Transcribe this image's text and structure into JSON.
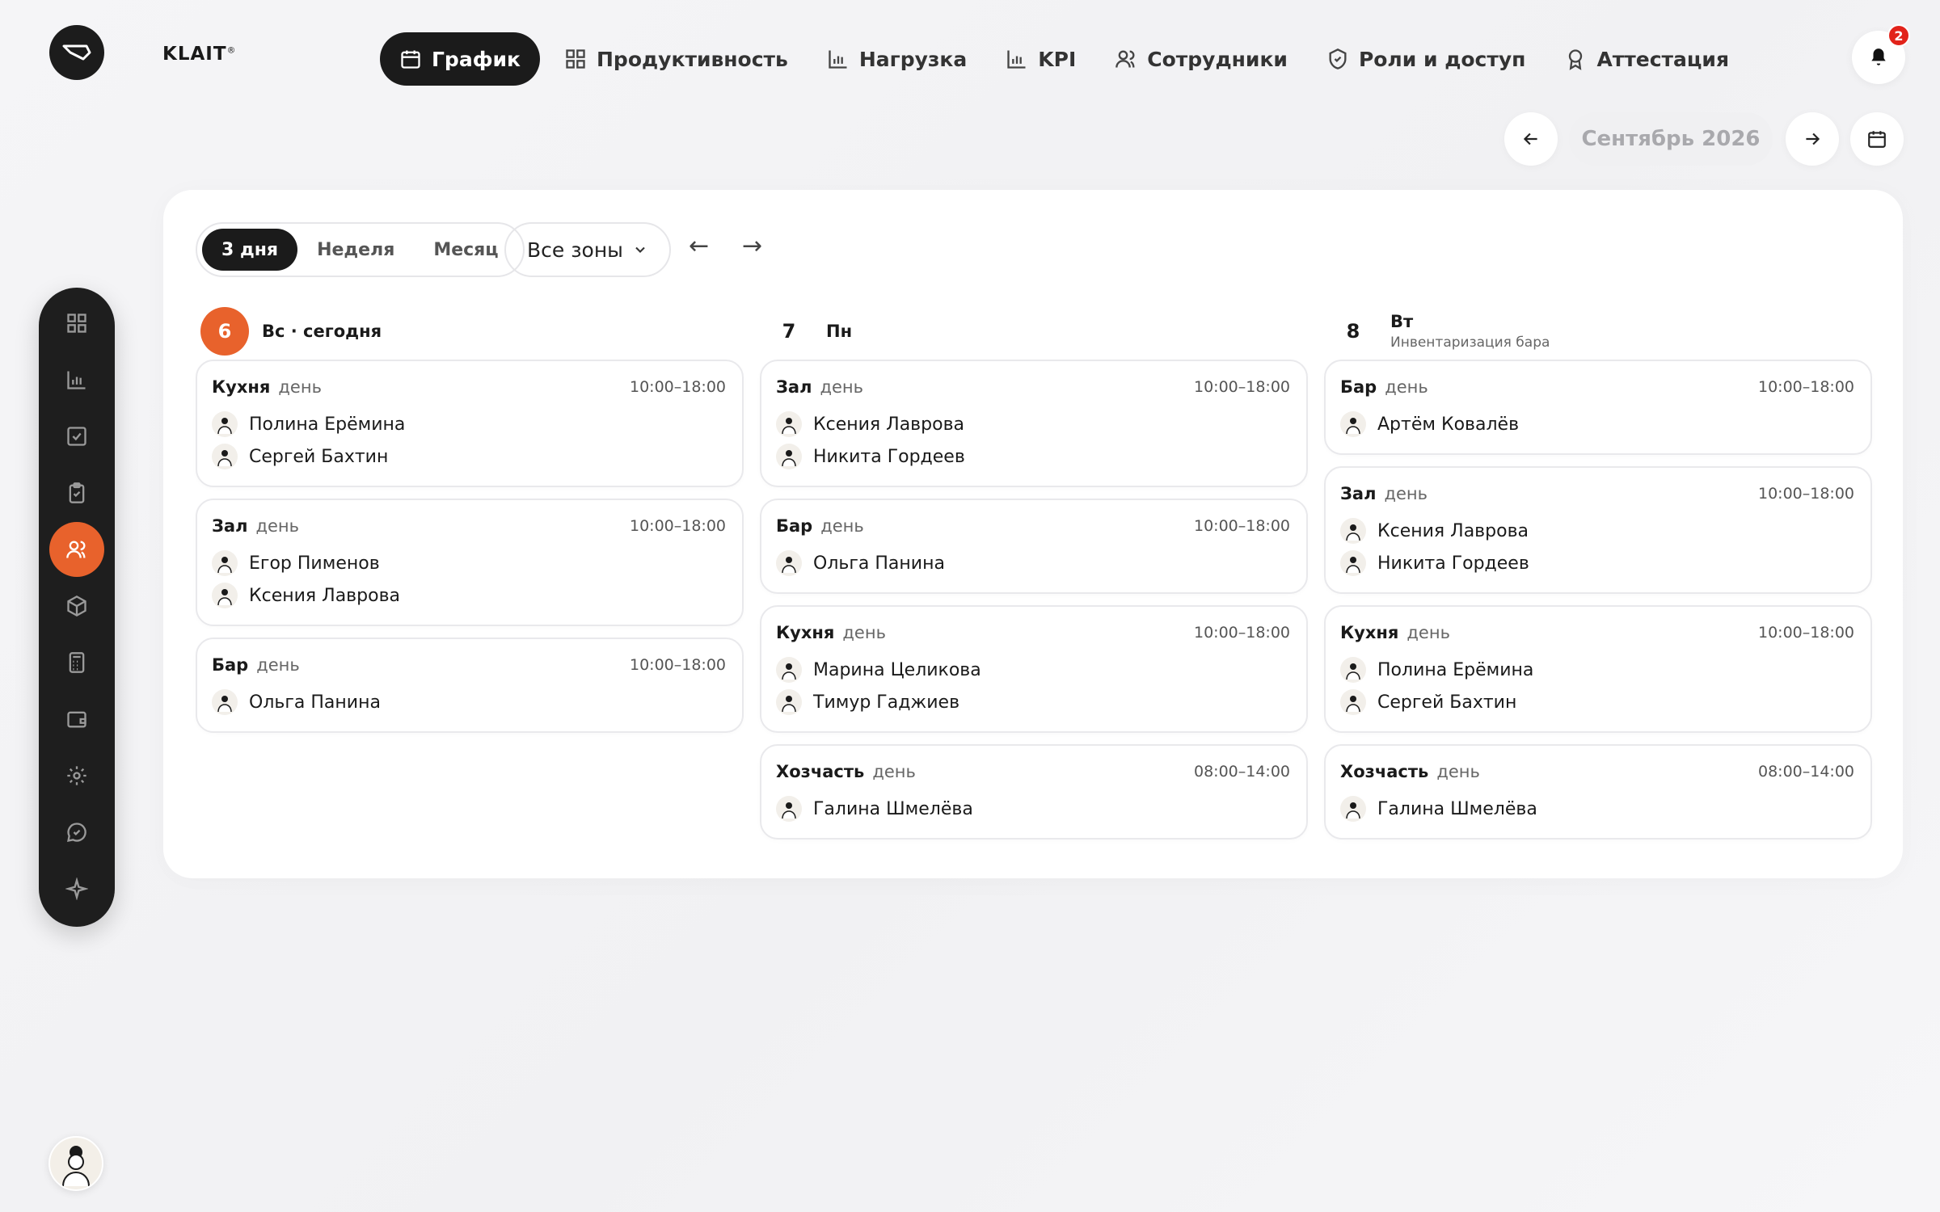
{
  "brand": {
    "name": "KLAIT",
    "mark": "®"
  },
  "nav": [
    {
      "label": "График",
      "icon": "calendar-icon",
      "active": true
    },
    {
      "label": "Продуктивность",
      "icon": "grid-icon"
    },
    {
      "label": "Нагрузка",
      "icon": "bar-chart-icon"
    },
    {
      "label": "KPI",
      "icon": "bar-chart-icon"
    },
    {
      "label": "Сотрудники",
      "icon": "users-icon"
    },
    {
      "label": "Роли и доступ",
      "icon": "shield-icon"
    },
    {
      "label": "Аттестация",
      "icon": "award-icon"
    }
  ],
  "notifications": {
    "count": "2",
    "icon": "bell-icon"
  },
  "month": {
    "label": "Сентябрь 2026"
  },
  "sidebar": {
    "items": [
      {
        "icon": "grid-icon"
      },
      {
        "icon": "bar-chart-icon"
      },
      {
        "icon": "checkbox-icon"
      },
      {
        "icon": "clipboard-icon"
      },
      {
        "icon": "users-icon",
        "active": true
      },
      {
        "icon": "box-icon"
      },
      {
        "icon": "calculator-icon"
      },
      {
        "icon": "wallet-icon"
      },
      {
        "icon": "gear-icon"
      },
      {
        "icon": "chat-icon"
      },
      {
        "icon": "sparkle-icon"
      }
    ],
    "accent": "#e8622c"
  },
  "view": {
    "options": [
      "3 дня",
      "Неделя",
      "Месяц"
    ],
    "active": "3 дня",
    "zones_label": "Все зоны",
    "prev": "←",
    "next": "→"
  },
  "days": [
    {
      "num": "6",
      "name": "Вс · сегодня",
      "note": "",
      "today": true,
      "cards": [
        {
          "zone": "Кухня",
          "shift": "день",
          "time": "10:00–18:00",
          "people": [
            "Полина Ерёмина",
            "Сергей Бахтин"
          ]
        },
        {
          "zone": "Зал",
          "shift": "день",
          "time": "10:00–18:00",
          "people": [
            "Егор Пименов",
            "Ксения Лаврова"
          ]
        },
        {
          "zone": "Бар",
          "shift": "день",
          "time": "10:00–18:00",
          "people": [
            "Ольга Панина"
          ]
        }
      ]
    },
    {
      "num": "7",
      "name": "Пн",
      "note": "",
      "today": false,
      "cards": [
        {
          "zone": "Зал",
          "shift": "день",
          "time": "10:00–18:00",
          "people": [
            "Ксения Лаврова",
            "Никита Гордеев"
          ]
        },
        {
          "zone": "Бар",
          "shift": "день",
          "time": "10:00–18:00",
          "people": [
            "Ольга Панина"
          ]
        },
        {
          "zone": "Кухня",
          "shift": "день",
          "time": "10:00–18:00",
          "people": [
            "Марина Целикова",
            "Тимур Гаджиев"
          ]
        },
        {
          "zone": "Хозчасть",
          "shift": "день",
          "time": "08:00–14:00",
          "people": [
            "Галина Шмелёва"
          ]
        }
      ]
    },
    {
      "num": "8",
      "name": "Вт",
      "note": "Инвентаризация бара",
      "today": false,
      "cards": [
        {
          "zone": "Бар",
          "shift": "день",
          "time": "10:00–18:00",
          "people": [
            "Артём Ковалёв"
          ]
        },
        {
          "zone": "Зал",
          "shift": "день",
          "time": "10:00–18:00",
          "people": [
            "Ксения Лаврова",
            "Никита Гордеев"
          ]
        },
        {
          "zone": "Кухня",
          "shift": "день",
          "time": "10:00–18:00",
          "people": [
            "Полина Ерёмина",
            "Сергей Бахтин"
          ]
        },
        {
          "zone": "Хозчасть",
          "shift": "день",
          "time": "08:00–14:00",
          "people": [
            "Галина Шмелёва"
          ]
        }
      ]
    }
  ]
}
